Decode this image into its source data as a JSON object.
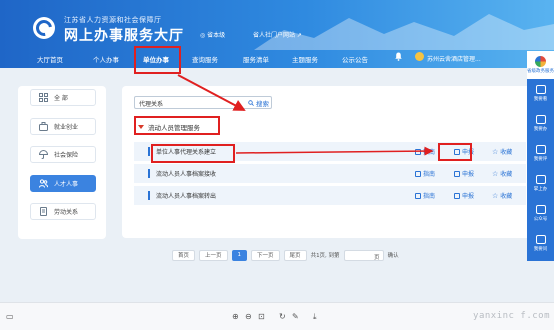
{
  "header": {
    "org_name": "江苏省人力资源和社会保障厅",
    "site_title": "网上办事服务大厅",
    "location": "◎ 省本级",
    "portal": "省人社门户网站 ↗"
  },
  "nav": {
    "items": [
      {
        "label": "大厅首页"
      },
      {
        "label": "个人办事"
      },
      {
        "label": "单位办事",
        "active": true
      },
      {
        "label": "查询服务"
      },
      {
        "label": "服务清单"
      },
      {
        "label": "主题服务"
      },
      {
        "label": "公示公告"
      }
    ],
    "user_name": "苏州云舍酒店管理..."
  },
  "sidebar": {
    "items": [
      {
        "label": "全 部",
        "icon": "grid-icon"
      },
      {
        "label": "就业创业",
        "icon": "briefcase-icon"
      },
      {
        "label": "社会保险",
        "icon": "umbrella-icon"
      },
      {
        "label": "人才人事",
        "icon": "people-icon",
        "active": true
      },
      {
        "label": "劳动关系",
        "icon": "contract-icon"
      }
    ]
  },
  "search": {
    "value": "代理关系",
    "button_label": "搜索"
  },
  "group": {
    "title": "流动人员管理服务"
  },
  "services": [
    {
      "name": "单位人事代理关系建立",
      "guide": "指南",
      "apply": "申报",
      "fav": "收藏"
    },
    {
      "name": "流动人员人事档案接收",
      "guide": "指南",
      "apply": "申报",
      "fav": "收藏"
    },
    {
      "name": "流动人员人事档案转出",
      "guide": "指南",
      "apply": "申报",
      "fav": "收藏"
    }
  ],
  "pager": {
    "first": "首页",
    "prev": "上一页",
    "current": "1",
    "next": "下一页",
    "last": "尾页",
    "summary": "共1页, 到第",
    "page_suffix": "页",
    "confirm": "确认"
  },
  "rightbar": {
    "top_label": "省级政务服务",
    "items": [
      {
        "label": "我要看"
      },
      {
        "label": "我要办"
      },
      {
        "label": "我要评"
      },
      {
        "label": "掌上办"
      },
      {
        "label": "公众号"
      },
      {
        "label": "我要问"
      }
    ]
  },
  "watermark": "yanxinc f.com",
  "colors": {
    "brand": "#1f66c7",
    "accent": "#2a73d5",
    "highlight": "#e02020"
  }
}
